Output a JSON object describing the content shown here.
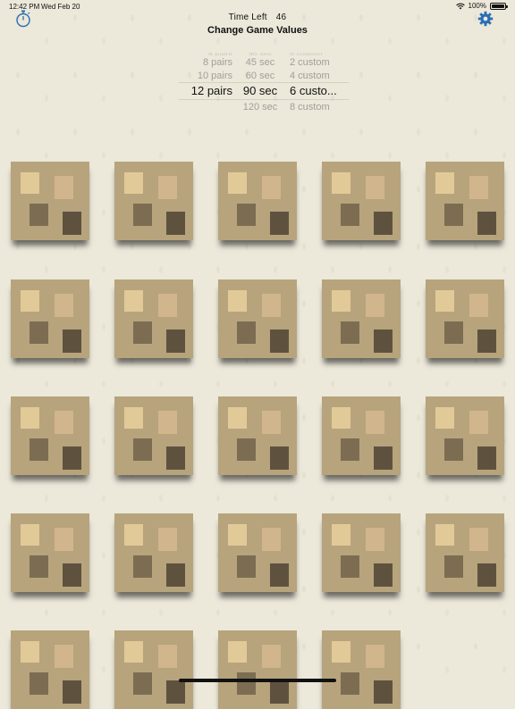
{
  "status_bar": {
    "time": "12:42 PM",
    "date": "Wed Feb 20",
    "battery": "100%",
    "wifi_icon": "wifi-icon",
    "battery_icon": "battery-icon"
  },
  "toolbar": {
    "stopwatch_icon": "stopwatch-icon",
    "settings_icon": "gear-icon"
  },
  "header": {
    "time_left_label": "Time Left",
    "time_left_value": "46",
    "title": "Change Game Values"
  },
  "picker": {
    "pairs": {
      "above2": "6 pairs",
      "above1": "8 pairs",
      "near": "10 pairs",
      "selected": "12 pairs"
    },
    "time": {
      "above2": "30 sec",
      "above1": "45 sec",
      "near": "60 sec",
      "selected": "90 sec",
      "below1": "120 sec"
    },
    "custom": {
      "above2": "0 custom",
      "above1": "2 custom",
      "near": "4 custom",
      "selected": "6 custo...",
      "below1": "8 custom"
    }
  },
  "colors": {
    "background": "#ece8da",
    "card_face": "#b7a47c",
    "square_light": "#e2c998",
    "square_tan": "#d1b58c",
    "square_mid": "#7c6d52",
    "square_dark": "#5e523f"
  },
  "cards": {
    "rows_visible": 5,
    "columns": 5
  }
}
